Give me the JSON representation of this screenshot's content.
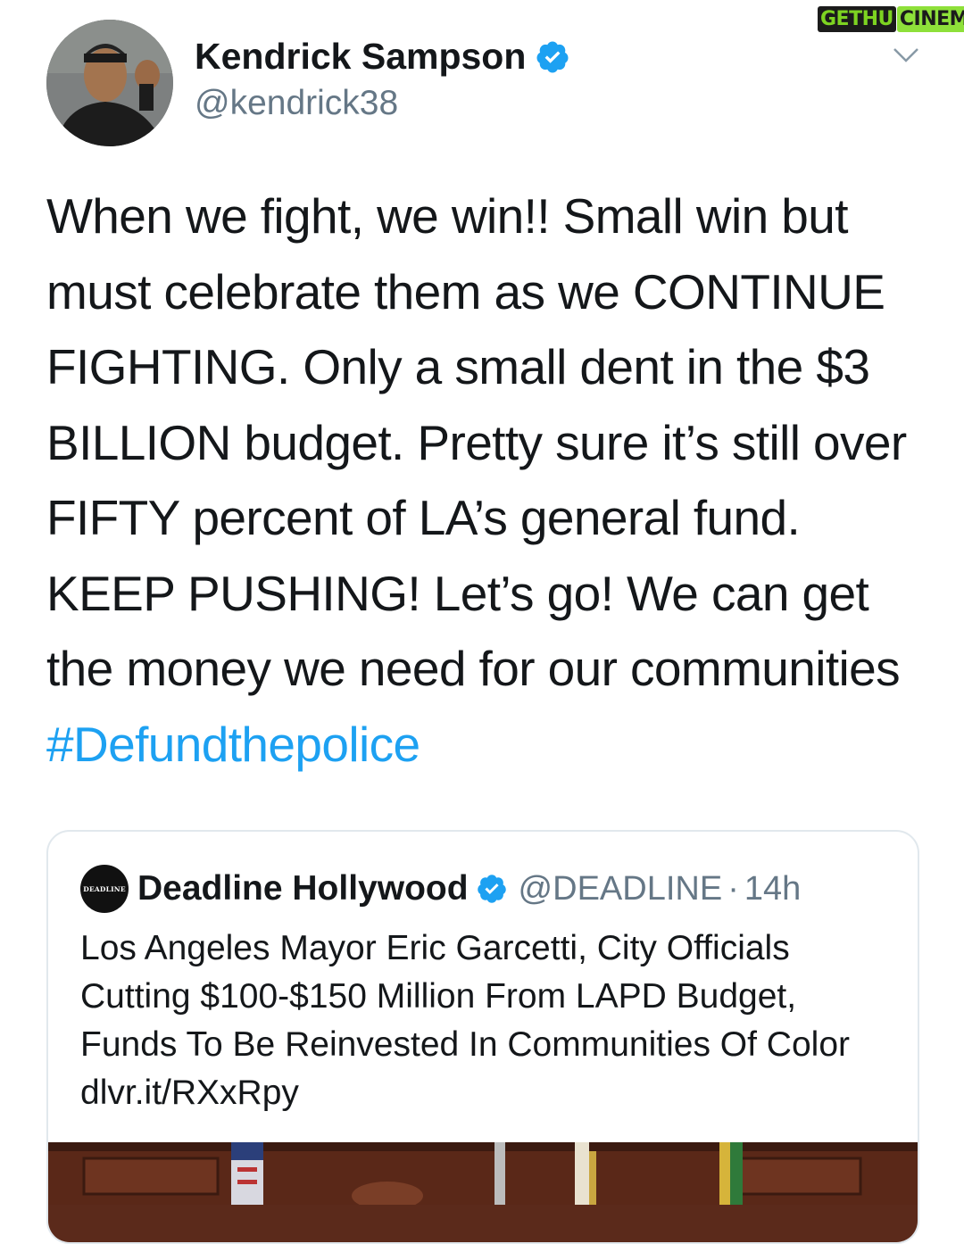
{
  "watermark": {
    "part1": "GETHU",
    "part2": "CINEMA"
  },
  "tweet": {
    "author_name": "Kendrick Sampson",
    "author_handle": "@kendrick38",
    "text_main": "When we fight, we win!! Small win but must celebrate them as we CONTINUE FIGHTING. Only a small dent in the $3 BILLION budget. Pretty sure it’s still over FIFTY percent of LA’s general fund. KEEP PUSHING! Let’s go! We can get the money we need for our communities ",
    "hashtag": "#Defundthepolice"
  },
  "quote": {
    "logo_text": "DEADLINE",
    "name": "Deadline Hollywood",
    "handle": "@DEADLINE",
    "separator": "·",
    "time": "14h",
    "text": "Los Angeles Mayor Eric Garcetti, City Officials Cutting $100-$150 Million From LAPD Budget, Funds To Be Reinvested In Communities Of Color dlvr.it/RXxRpy"
  },
  "colors": {
    "link_blue": "#1da1f2",
    "verified_blue": "#1da1f2",
    "text_primary": "#14171a",
    "text_secondary": "#657786",
    "border": "#e1e8ed"
  },
  "icons": {
    "verified": "verified-badge-icon",
    "more": "chevron-down-icon"
  }
}
